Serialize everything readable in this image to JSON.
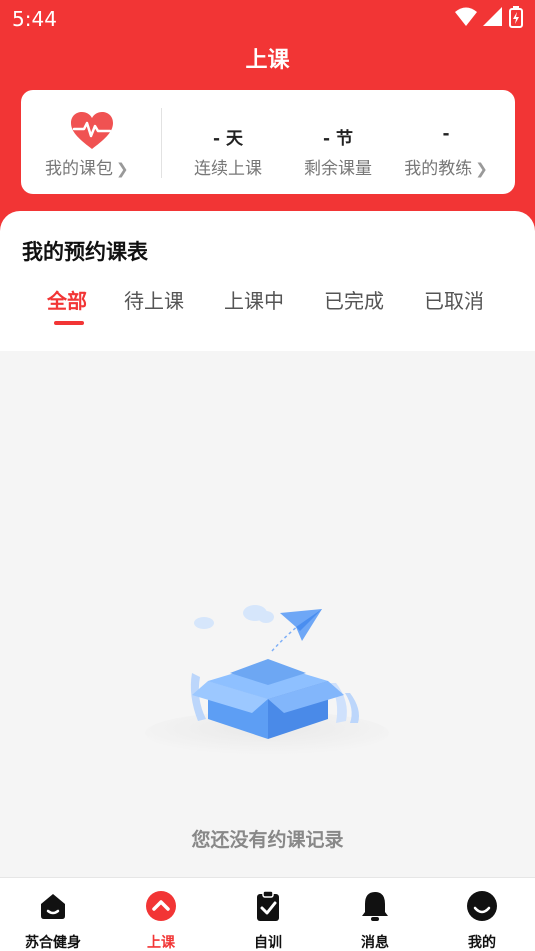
{
  "status_bar": {
    "time": "5:44"
  },
  "header": {
    "title": "上课"
  },
  "summary": {
    "pack_label": "我的课包",
    "stats": [
      {
        "value": "- 天",
        "label": "连续上课"
      },
      {
        "value": "- 节",
        "label": "剩余课量"
      },
      {
        "value": "-",
        "label": "我的教练"
      }
    ]
  },
  "schedule": {
    "heading": "我的预约课表",
    "tabs": [
      "全部",
      "待上课",
      "上课中",
      "已完成",
      "已取消"
    ],
    "active_tab": "全部"
  },
  "empty_state": {
    "message": "您还没有约课记录"
  },
  "bottom_nav": {
    "items": [
      {
        "label": "苏合健身",
        "icon": "home-icon"
      },
      {
        "label": "上课",
        "icon": "chevron-up-circle-icon"
      },
      {
        "label": "自训",
        "icon": "clipboard-check-icon"
      },
      {
        "label": "消息",
        "icon": "bell-icon"
      },
      {
        "label": "我的",
        "icon": "smile-face-icon"
      }
    ],
    "active": "上课"
  },
  "colors": {
    "accent": "#f23535",
    "background": "#f5f5f5"
  }
}
